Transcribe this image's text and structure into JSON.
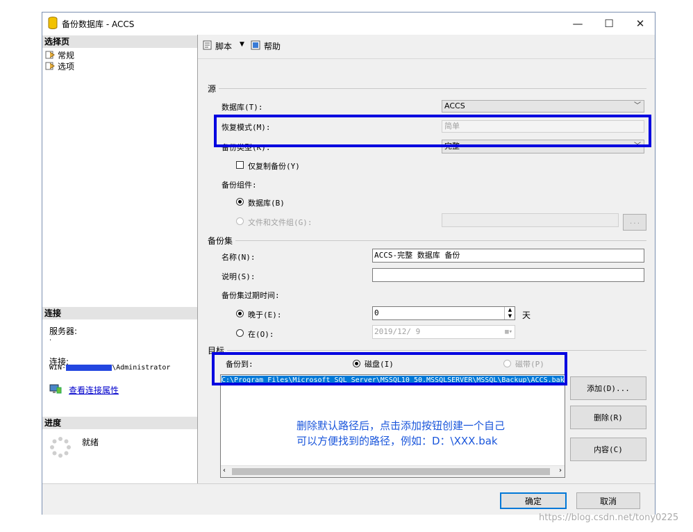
{
  "window": {
    "title": "备份数据库 - ACCS",
    "controls": {
      "minimize": "—",
      "maximize": "☐",
      "close": "✕"
    }
  },
  "left_pane": {
    "select_page_header": "选择页",
    "pages": [
      {
        "label": "常规"
      },
      {
        "label": "选项"
      }
    ],
    "connection_header": "连接",
    "server_label": "服务器:",
    "server_value": ".",
    "connection_label": "连接:",
    "connection_value_prefix": "WIN-",
    "connection_value_suffix": "\\Administrator",
    "view_connection_link": "查看连接属性",
    "progress_header": "进度",
    "progress_status": "就绪"
  },
  "toolbar": {
    "script_label": "脚本",
    "help_label": "帮助"
  },
  "source": {
    "section_label": "源",
    "database_label": "数据库(T):",
    "database_value": "ACCS",
    "recovery_label": "恢复模式(M):",
    "recovery_value": "简单",
    "backup_type_label": "备份类型(K):",
    "backup_type_value": "完整",
    "copy_only_label": "仅复制备份(Y)",
    "component_label": "备份组件:",
    "component_db_label": "数据库(B)",
    "component_files_label": "文件和文件组(G):",
    "browse_label": "..."
  },
  "backup_set": {
    "section_label": "备份集",
    "name_label": "名称(N):",
    "name_value": "ACCS-完整 数据库 备份",
    "desc_label": "说明(S):",
    "desc_value": "",
    "expire_label": "备份集过期时间:",
    "after_label": "晚于(E):",
    "after_value": "0",
    "days_unit": "天",
    "on_label": "在(O):",
    "on_value": "2019/12/ 9"
  },
  "destination": {
    "section_label": "目标",
    "backup_to_label": "备份到:",
    "disk_label": "磁盘(I)",
    "tape_label": "磁带(P)",
    "path_value": "C:\\Program Files\\Microsoft SQL Server\\MSSQL10_50.MSSQLSERVER\\MSSQL\\Backup\\ACCS.bak",
    "add_label": "添加(D)...",
    "remove_label": "删除(R)",
    "contents_label": "内容(C)",
    "annotation_line1": "删除默认路径后，点击添加按钮创建一个自己",
    "annotation_line2": "可以方便找到的路径，例如：D：\\XXX.bak"
  },
  "buttons": {
    "ok_label": "确定",
    "cancel_label": "取消"
  },
  "watermark": "https://blog.csdn.net/tony0225",
  "colors": {
    "highlight": "#0000e0",
    "annotation": "#1a56db",
    "selection": "#0078d7",
    "link": "#0000cc"
  }
}
